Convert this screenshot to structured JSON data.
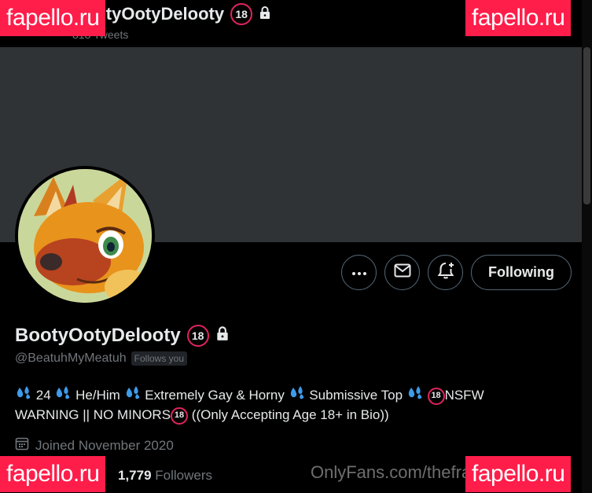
{
  "header": {
    "title": "BootyOotyDelooty",
    "tweets_count": "818 Tweets"
  },
  "profile": {
    "display_name": "BootyOotyDelooty",
    "badge_18": "18",
    "handle": "@BeatuhMyMeatuh",
    "follows_you": "Follows you",
    "bio": {
      "seg1": "24",
      "seg2": "He/Him",
      "seg3": "Extremely Gay & Horny",
      "seg4": "Submissive Top",
      "seg5": "NSFW",
      "line2a": "WARNING || NO MINORS",
      "line2b": "((Only Accepting Age 18+ in Bio))"
    },
    "joined": "Joined November 2020",
    "followers_count": "1,779",
    "followers_label": "Followers"
  },
  "actions": {
    "following_label": "Following"
  },
  "watermarks": {
    "corner": "fapello.ru",
    "onlyfans": "OnlyFans.com/thefrappello.ru"
  },
  "colors": {
    "background": "#000000",
    "banner": "#2f3336",
    "muted": "#71767b",
    "watermark": "#ff1d4a",
    "drop": "#3d9be9",
    "eighteen_ring": "#e0245e"
  },
  "icons": [
    "more-icon",
    "mail-icon",
    "bell-plus-icon",
    "lock-icon",
    "calendar-icon",
    "droplets-icon",
    "eighteen-icon"
  ]
}
